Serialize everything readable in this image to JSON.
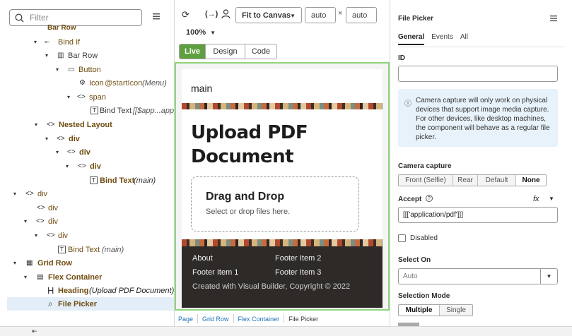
{
  "left_panel": {
    "filter_placeholder": "Filter",
    "tree": [
      {
        "label": "Bar Row",
        "caret": "",
        "icon": "",
        "extra": ""
      },
      {
        "label": "Bind If",
        "caret": "▾",
        "icon": "⟜",
        "extra": ""
      },
      {
        "label": "Bar Row",
        "caret": "▾",
        "icon": "▥",
        "extra": ""
      },
      {
        "label": "Button",
        "caret": "▾",
        "icon": "▭",
        "extra": ""
      },
      {
        "label": "Icon",
        "caret": "",
        "icon": "⚙",
        "extra": "@startIcon",
        "extra2": "(Menu)"
      },
      {
        "label": "span",
        "caret": "▾",
        "icon": "<>",
        "extra": ""
      },
      {
        "label": "Bind Text",
        "caret": "",
        "icon": "T",
        "extra": "[[$app...app_t"
      },
      {
        "label": "Nested Layout",
        "caret": "▾",
        "icon": "<>",
        "extra": ""
      },
      {
        "label": "div",
        "caret": "▾",
        "icon": "<>",
        "extra": ""
      },
      {
        "label": "div",
        "caret": "▾",
        "icon": "<>",
        "extra": ""
      },
      {
        "label": "div",
        "caret": "▾",
        "icon": "<>",
        "extra": ""
      },
      {
        "label": "Bind Text",
        "caret": "",
        "icon": "T",
        "extra": "(main)"
      },
      {
        "label": "div",
        "caret": "▾",
        "icon": "<>",
        "extra": ""
      },
      {
        "label": "div",
        "caret": "",
        "icon": "<>",
        "extra": ""
      },
      {
        "label": "div",
        "caret": "▾",
        "icon": "<>",
        "extra": ""
      },
      {
        "label": "div",
        "caret": "▾",
        "icon": "<>",
        "extra": ""
      },
      {
        "label": "Bind Text",
        "caret": "",
        "icon": "T",
        "extra": "(main)"
      },
      {
        "label": "Grid Row",
        "caret": "▾",
        "icon": "▦",
        "extra": ""
      },
      {
        "label": "Flex Container",
        "caret": "▾",
        "icon": "▤",
        "extra": ""
      },
      {
        "label": "Heading",
        "caret": "",
        "icon": "H",
        "extra": "(Upload PDF Document)"
      },
      {
        "label": "File Picker",
        "caret": "",
        "icon": "⌕",
        "extra": ""
      }
    ]
  },
  "toolbar": {
    "fit_label": "Fit to Canvas",
    "width_value": "auto",
    "height_value": "auto",
    "times": "×",
    "zoom": "100%",
    "modes": [
      "Live",
      "Design",
      "Code"
    ]
  },
  "preview": {
    "main_text": "main",
    "heading": "Upload PDF Document",
    "drop_title": "Drag and Drop",
    "drop_sub": "Select or drop files here.",
    "footer_items": [
      "About",
      "Footer Item 2",
      "Footer Item 1",
      "Footer Item 3"
    ],
    "copyright": "Created with Visual Builder, Copyright © 2022"
  },
  "breadcrumb": [
    "Page",
    "Grid Row",
    "Flex Container",
    "File Picker"
  ],
  "properties": {
    "title": "File Picker",
    "tabs": [
      "General",
      "Events",
      "All"
    ],
    "id_label": "ID",
    "info_text": "Camera capture will only work on physical devices that support image media capture. For other devices, like desktop machines, the component will behave as a regular file picker.",
    "camera_label": "Camera capture",
    "camera_options": [
      "Front (Selfie)",
      "Rear",
      "Default",
      "None"
    ],
    "accept_label": "Accept",
    "accept_value": "[[['application/pdf']]]",
    "fx": "fx",
    "disabled_label": "Disabled",
    "select_on_label": "Select On",
    "select_on_value": "Auto",
    "selection_mode_label": "Selection Mode",
    "selection_modes": [
      "Multiple",
      "Single"
    ]
  }
}
